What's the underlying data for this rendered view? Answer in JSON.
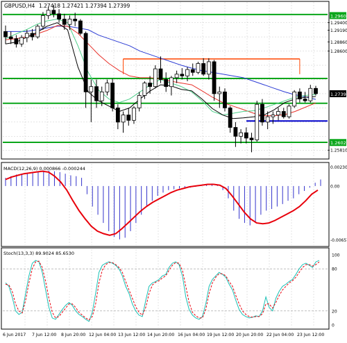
{
  "header": {
    "symbol": "GBPUSD,H4",
    "ohlc": "1.27418 1.27421 1.27394 1.27399"
  },
  "colors": {
    "background": "#ffffff",
    "frame": "#000000",
    "grid": "#c8c8c8",
    "candle_up": "#ffffff",
    "candle_down": "#000000",
    "level_green": "#0aa61a",
    "level_blue": "#0000cc",
    "level_orange": "#ff4500",
    "ma_red": "#e8312a",
    "ma_blue": "#2b3bd4",
    "ma_seagreen": "#4ecf8a",
    "ma_black": "#000000",
    "macd_hist": "#3333cc",
    "macd_signal": "#e8000b",
    "stoch_main": "#19c0b5",
    "stoch_signal": "#e8000b",
    "price_box": "#000000",
    "label_box": "#0aa61a"
  },
  "chart_data": [
    {
      "type": "line",
      "panel": "price",
      "title": "GBPUSD,H4",
      "ylim": [
        1.2558,
        1.2998
      ],
      "price_labels": [
        "1.29600",
        "1.29400",
        "1.29190",
        "1.28860",
        "1.28600",
        "1.27399",
        "1.26025",
        "1.25810"
      ],
      "levels": [
        {
          "value": 1.2963,
          "color": "green",
          "label": "1.29600"
        },
        {
          "value": 1.2783,
          "color": "green",
          "label": ""
        },
        {
          "value": 1.2713,
          "color": "green",
          "label": ""
        },
        {
          "value": 1.2663,
          "color": "blue",
          "label": ""
        },
        {
          "value": 1.2603,
          "color": "green",
          "label": "1.26025"
        },
        {
          "value": 1.2838,
          "color": "orange",
          "label": "",
          "range": [
            22,
            55
          ]
        }
      ],
      "x_labels": [
        "6 Jun 2017",
        "7 Jun 12:00",
        "8 Jun 20:00",
        "12 Jun 04:00",
        "13 Jun 12:00",
        "14 Jun 20:00",
        "16 Jun 04:00",
        "19 Jun 12:00",
        "20 Jun 20:00",
        "22 Jun 04:00",
        "23 Jun 12:00"
      ],
      "candles": [
        [
          1.2915,
          1.2932,
          1.288,
          1.29
        ],
        [
          1.29,
          1.2915,
          1.288,
          1.2895
        ],
        [
          1.2895,
          1.2905,
          1.287,
          1.288
        ],
        [
          1.288,
          1.2905,
          1.2872,
          1.2898
        ],
        [
          1.2898,
          1.292,
          1.2885,
          1.291
        ],
        [
          1.291,
          1.2922,
          1.289,
          1.29
        ],
        [
          1.29,
          1.2935,
          1.2895,
          1.293
        ],
        [
          1.293,
          1.297,
          1.292,
          1.296
        ],
        [
          1.296,
          1.2985,
          1.295,
          1.2975
        ],
        [
          1.2975,
          1.299,
          1.2955,
          1.2965
        ],
        [
          1.2965,
          1.2978,
          1.294,
          1.295
        ],
        [
          1.295,
          1.2965,
          1.292,
          1.2935
        ],
        [
          1.2935,
          1.296,
          1.292,
          1.295
        ],
        [
          1.295,
          1.2968,
          1.293,
          1.2945
        ],
        [
          1.2945,
          1.295,
          1.2905,
          1.291
        ],
        [
          1.291,
          1.2915,
          1.27,
          1.2745
        ],
        [
          1.2745,
          1.278,
          1.266,
          1.276
        ],
        [
          1.276,
          1.278,
          1.27,
          1.272
        ],
        [
          1.272,
          1.276,
          1.2705,
          1.2745
        ],
        [
          1.2745,
          1.278,
          1.2735,
          1.277
        ],
        [
          1.277,
          1.2782,
          1.269,
          1.27
        ],
        [
          1.27,
          1.271,
          1.264,
          1.266
        ],
        [
          1.266,
          1.269,
          1.263,
          1.268
        ],
        [
          1.268,
          1.27,
          1.265,
          1.2665
        ],
        [
          1.2665,
          1.2705,
          1.2655,
          1.27
        ],
        [
          1.27,
          1.2745,
          1.269,
          1.2735
        ],
        [
          1.2735,
          1.2775,
          1.2725,
          1.277
        ],
        [
          1.277,
          1.279,
          1.274,
          1.276
        ],
        [
          1.276,
          1.282,
          1.2755,
          1.281
        ],
        [
          1.281,
          1.2845,
          1.277,
          1.278
        ],
        [
          1.278,
          1.28,
          1.2745,
          1.276
        ],
        [
          1.276,
          1.279,
          1.2735,
          1.2785
        ],
        [
          1.2785,
          1.2805,
          1.277,
          1.2795
        ],
        [
          1.2795,
          1.2812,
          1.278,
          1.279
        ],
        [
          1.279,
          1.2815,
          1.2775,
          1.2808
        ],
        [
          1.2808,
          1.2825,
          1.279,
          1.28
        ],
        [
          1.28,
          1.283,
          1.2795,
          1.2825
        ],
        [
          1.2825,
          1.284,
          1.279,
          1.2795
        ],
        [
          1.2795,
          1.284,
          1.278,
          1.283
        ],
        [
          1.283,
          1.2835,
          1.272,
          1.274
        ],
        [
          1.274,
          1.276,
          1.27,
          1.2745
        ],
        [
          1.2745,
          1.2755,
          1.269,
          1.27
        ],
        [
          1.27,
          1.2705,
          1.263,
          1.2645
        ],
        [
          1.2645,
          1.266,
          1.259,
          1.262
        ],
        [
          1.262,
          1.264,
          1.26,
          1.263
        ],
        [
          1.263,
          1.2645,
          1.26,
          1.2615
        ],
        [
          1.2615,
          1.263,
          1.2575,
          1.261
        ],
        [
          1.261,
          1.272,
          1.2605,
          1.271
        ],
        [
          1.271,
          1.2725,
          1.265,
          1.266
        ],
        [
          1.266,
          1.269,
          1.264,
          1.2675
        ],
        [
          1.2675,
          1.269,
          1.2655,
          1.268
        ],
        [
          1.268,
          1.27,
          1.2665,
          1.269
        ],
        [
          1.269,
          1.27,
          1.267,
          1.2675
        ],
        [
          1.2675,
          1.271,
          1.267,
          1.2705
        ],
        [
          1.2705,
          1.275,
          1.27,
          1.2745
        ],
        [
          1.2745,
          1.2755,
          1.2715,
          1.2725
        ],
        [
          1.2725,
          1.2745,
          1.2715,
          1.272
        ],
        [
          1.272,
          1.2765,
          1.2715,
          1.2755
        ],
        [
          1.2755,
          1.2762,
          1.2735,
          1.274
        ]
      ],
      "series": [
        {
          "values": [
            1.2915,
            1.2915,
            1.2915,
            1.292,
            1.2925,
            1.293,
            1.293,
            1.2925,
            1.292,
            1.2905,
            1.2895,
            1.2885,
            1.2875,
            1.286,
            1.285,
            1.284,
            1.283,
            1.282,
            1.2812,
            1.2805,
            1.28,
            1.2795,
            1.279,
            1.2785,
            1.2775,
            1.2765,
            1.2755,
            1.2745,
            1.2737,
            1.2731,
            1.2724
          ]
        },
        {
          "values": [
            1.2892,
            1.2895,
            1.29,
            1.2908,
            1.2918,
            1.2932,
            1.293,
            1.291,
            1.288,
            1.285,
            1.2825,
            1.2805,
            1.279,
            1.2785,
            1.2785,
            1.2782,
            1.2775,
            1.277,
            1.2765,
            1.2748,
            1.273,
            1.2715,
            1.2705,
            1.2695,
            1.2685,
            1.2678,
            1.2678,
            1.2681,
            1.269,
            1.2702,
            1.2714
          ]
        },
        {
          "values": [
            1.2895,
            1.2908,
            1.292,
            1.2935,
            1.2945,
            1.295,
            1.294,
            1.2875,
            1.28,
            1.275,
            1.2725,
            1.2715,
            1.2725,
            1.2745,
            1.2765,
            1.278,
            1.277,
            1.276,
            1.2745,
            1.272,
            1.269,
            1.268,
            1.2685,
            1.269,
            1.2692,
            1.27,
            1.271,
            1.272,
            1.273,
            1.2735,
            1.2738
          ]
        },
        {
          "values": [
            1.288,
            1.2885,
            1.2898,
            1.2912,
            1.293,
            1.294,
            1.292,
            1.2815,
            1.2745,
            1.272,
            1.2705,
            1.269,
            1.27,
            1.2725,
            1.2748,
            1.2765,
            1.2762,
            1.2752,
            1.2748,
            1.2725,
            1.2698,
            1.268,
            1.267,
            1.2672,
            1.2675,
            1.268,
            1.2695,
            1.2715,
            1.2725,
            1.273,
            1.2732
          ]
        }
      ]
    },
    {
      "type": "bar",
      "panel": "macd",
      "title": "MACD(12,26,9) 0.000866 -0.000244",
      "ylim": [
        -0.0072,
        0.0027
      ],
      "axis_labels": [
        "0.002301",
        "0.00",
        "-0.006577"
      ],
      "values": [
        0.001,
        0.0012,
        0.0014,
        0.0015,
        0.0016,
        0.0017,
        0.0018,
        0.0019,
        0.0019,
        0.0018,
        0.0017,
        0.0015,
        0.0013,
        0.0012,
        0.001,
        -0.001,
        -0.0025,
        -0.0035,
        -0.0045,
        -0.0055,
        -0.0062,
        -0.0065,
        -0.0063,
        -0.0055,
        -0.0045,
        -0.0035,
        -0.0025,
        -0.0018,
        -0.0012,
        -0.0008,
        -0.0005,
        -0.0004,
        -0.0003,
        -0.0002,
        -0.0002,
        -0.0001,
        0.0001,
        0.0002,
        0.0003,
        0.0002,
        -0.0005,
        -0.0015,
        -0.003,
        -0.004,
        -0.0045,
        -0.0048,
        -0.0045,
        -0.0035,
        -0.003,
        -0.0028,
        -0.0025,
        -0.0022,
        -0.0018,
        -0.0015,
        -0.001,
        -0.0006,
        -0.0002,
        0.0004,
        0.0008
      ],
      "signal": [
        0.0008,
        0.0011,
        0.0013,
        0.0015,
        0.0016,
        0.0017,
        0.0018,
        0.0017,
        0.0012,
        0.0005,
        -0.0005,
        -0.0018,
        -0.003,
        -0.004,
        -0.0049,
        -0.0055,
        -0.0058,
        -0.006,
        -0.0058,
        -0.0052,
        -0.0045,
        -0.0038,
        -0.0031,
        -0.0025,
        -0.002,
        -0.0016,
        -0.0012,
        -0.0008,
        -0.0005,
        -0.0003,
        -0.0001,
        0.0,
        0.0001,
        0.0002,
        0.0002,
        0.0001,
        -0.0003,
        -0.0012,
        -0.0022,
        -0.0032,
        -0.004,
        -0.0045,
        -0.0046,
        -0.0045,
        -0.0042,
        -0.0038,
        -0.0034,
        -0.003,
        -0.0025,
        -0.0018,
        -0.001,
        -0.0005
      ]
    },
    {
      "type": "line",
      "panel": "stochastic",
      "title": "Stoch(13,3,3) 89.9024 85.6530",
      "ylim": [
        0,
        100
      ],
      "axis_labels": [
        "100",
        "80",
        "20",
        "0"
      ],
      "series": [
        {
          "values": [
            60,
            55,
            40,
            20,
            15,
            18,
            45,
            70,
            88,
            92,
            90,
            75,
            50,
            25,
            10,
            8,
            15,
            22,
            28,
            32,
            28,
            20,
            15,
            12,
            8,
            5,
            18,
            45,
            75,
            85,
            88,
            90,
            88,
            85,
            80,
            70,
            55,
            45,
            30,
            20,
            14,
            12,
            35,
            55,
            60,
            62,
            65,
            70,
            72,
            82,
            88,
            90,
            86,
            70,
            40,
            22,
            14,
            10,
            8,
            12,
            30,
            55,
            65,
            70,
            75,
            72,
            68,
            58,
            50,
            35,
            22,
            15,
            12,
            10,
            11,
            13,
            12,
            20,
            40,
            25,
            20,
            38,
            48,
            55,
            58,
            62,
            65,
            72,
            80,
            86,
            88,
            85,
            82,
            90,
            92
          ]
        },
        {
          "values": [
            58,
            57,
            48,
            30,
            20,
            17,
            35,
            60,
            80,
            90,
            91,
            82,
            62,
            38,
            18,
            10,
            12,
            18,
            24,
            30,
            30,
            25,
            18,
            14,
            10,
            7,
            12,
            30,
            60,
            78,
            86,
            89,
            89,
            86,
            82,
            75,
            62,
            50,
            38,
            26,
            18,
            14,
            25,
            45,
            57,
            61,
            63,
            67,
            70,
            78,
            85,
            89,
            88,
            78,
            55,
            32,
            18,
            13,
            10,
            10,
            22,
            45,
            60,
            68,
            73,
            73,
            70,
            62,
            55,
            42,
            30,
            20,
            15,
            12,
            11,
            12,
            12,
            16,
            30,
            30,
            24,
            32,
            42,
            50,
            55,
            60,
            63,
            68,
            75,
            82,
            86,
            86,
            84,
            86,
            90
          ]
        }
      ]
    }
  ]
}
